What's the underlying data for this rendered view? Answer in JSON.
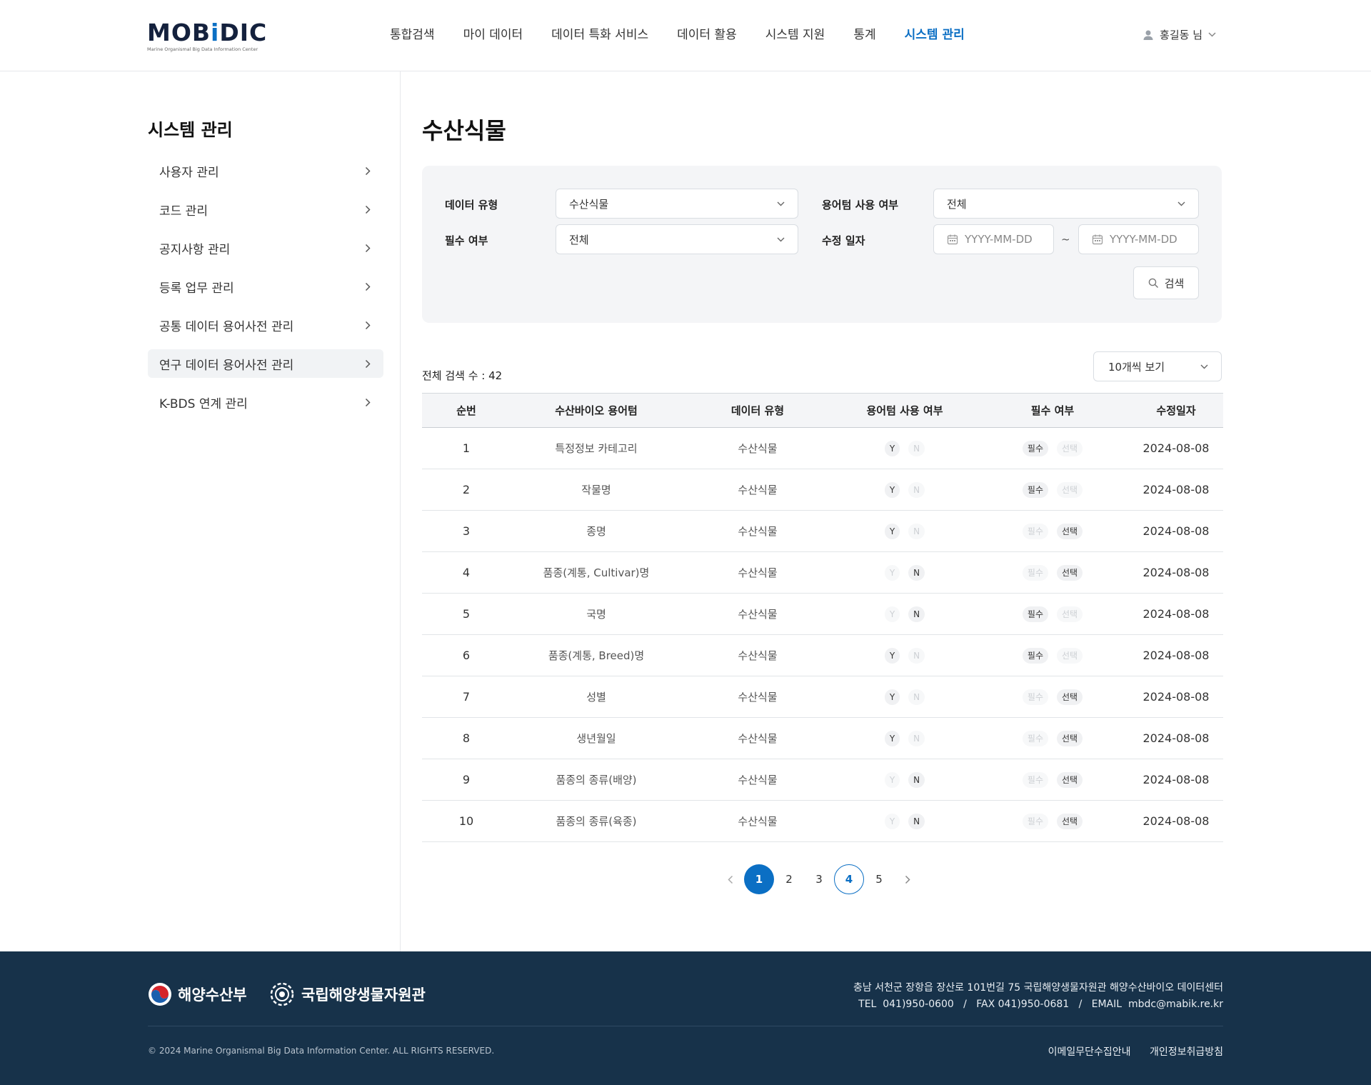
{
  "header": {
    "logo_text": "MOBiDIC",
    "logo_sub": "Marine Organismal Big Data Information Center",
    "nav": [
      "통합검색",
      "마이 데이터",
      "데이터 특화 서비스",
      "데이터 활용",
      "시스템 지원",
      "통계",
      "시스템 관리"
    ],
    "active_nav": "시스템 관리",
    "user": "홍길동 님"
  },
  "sidebar": {
    "title": "시스템 관리",
    "items": [
      "사용자 관리",
      "코드 관리",
      "공지사항 관리",
      "등록 업무 관리",
      "공통 데이터 용어사전 관리",
      "연구 데이터 용어사전 관리",
      "K-BDS 연계 관리"
    ],
    "active_item": "연구 데이터 용어사전 관리"
  },
  "page": {
    "title": "수산식물"
  },
  "filter": {
    "data_type_label": "데이터 유형",
    "data_type_value": "수산식물",
    "term_use_label": "용어텀 사용 여부",
    "term_use_value": "전체",
    "required_label": "필수 여부",
    "required_value": "전체",
    "modified_label": "수정 일자",
    "date_from_placeholder": "YYYY-MM-DD",
    "date_to_placeholder": "YYYY-MM-DD",
    "date_sep": "~",
    "search_label": "검색"
  },
  "results": {
    "total_text": "전체 검색 수 : 42",
    "per_page": "10개씩 보기"
  },
  "table": {
    "headers": [
      "순번",
      "수산바이오 용어텀",
      "데이터 유형",
      "용어텀 사용 여부",
      "필수 여부",
      "수정일자"
    ],
    "chip_labels": {
      "yes": "Y",
      "no": "N",
      "required": "필수",
      "optional": "선택"
    },
    "rows": [
      {
        "no": "1",
        "term": "특정정보 카테고리",
        "type": "수산식물",
        "use": "Y",
        "required": "필수",
        "date": "2024-08-08"
      },
      {
        "no": "2",
        "term": "작물명",
        "type": "수산식물",
        "use": "Y",
        "required": "필수",
        "date": "2024-08-08"
      },
      {
        "no": "3",
        "term": "종명",
        "type": "수산식물",
        "use": "Y",
        "required": "선택",
        "date": "2024-08-08"
      },
      {
        "no": "4",
        "term": "품종(계통, Cultivar)명",
        "type": "수산식물",
        "use": "N",
        "required": "선택",
        "date": "2024-08-08"
      },
      {
        "no": "5",
        "term": "국명",
        "type": "수산식물",
        "use": "N",
        "required": "필수",
        "date": "2024-08-08"
      },
      {
        "no": "6",
        "term": "품종(계통, Breed)명",
        "type": "수산식물",
        "use": "Y",
        "required": "필수",
        "date": "2024-08-08"
      },
      {
        "no": "7",
        "term": "성별",
        "type": "수산식물",
        "use": "Y",
        "required": "선택",
        "date": "2024-08-08"
      },
      {
        "no": "8",
        "term": "생년월일",
        "type": "수산식물",
        "use": "Y",
        "required": "선택",
        "date": "2024-08-08"
      },
      {
        "no": "9",
        "term": "품종의 종류(배양)",
        "type": "수산식물",
        "use": "N",
        "required": "선택",
        "date": "2024-08-08"
      },
      {
        "no": "10",
        "term": "품종의 종류(육종)",
        "type": "수산식물",
        "use": "N",
        "required": "선택",
        "date": "2024-08-08"
      }
    ]
  },
  "pagination": {
    "pages": [
      "1",
      "2",
      "3",
      "4",
      "5"
    ],
    "current": "1",
    "outlined": "4"
  },
  "footer": {
    "logo1": "해양수산부",
    "logo2": "국립해양생물자원관",
    "address": "충남 서천군 장항읍 장산로 101번길 75 국립해양생물자원관 해양수산바이오 데이터센터",
    "contact": "TEL  041)950-0600   /   FAX 041)950-0681   /   EMAIL  mbdc@mabik.re.kr",
    "copyright": "© 2024 Marine Organismal Big Data Information Center. ALL RIGHTS RESERVED.",
    "links": [
      "이메일무단수집안내",
      "개인정보취급방침"
    ]
  },
  "colors": {
    "accent": "#0b6fc4",
    "footer_bg": "#17324a",
    "panel_bg": "#f4f5f7"
  }
}
